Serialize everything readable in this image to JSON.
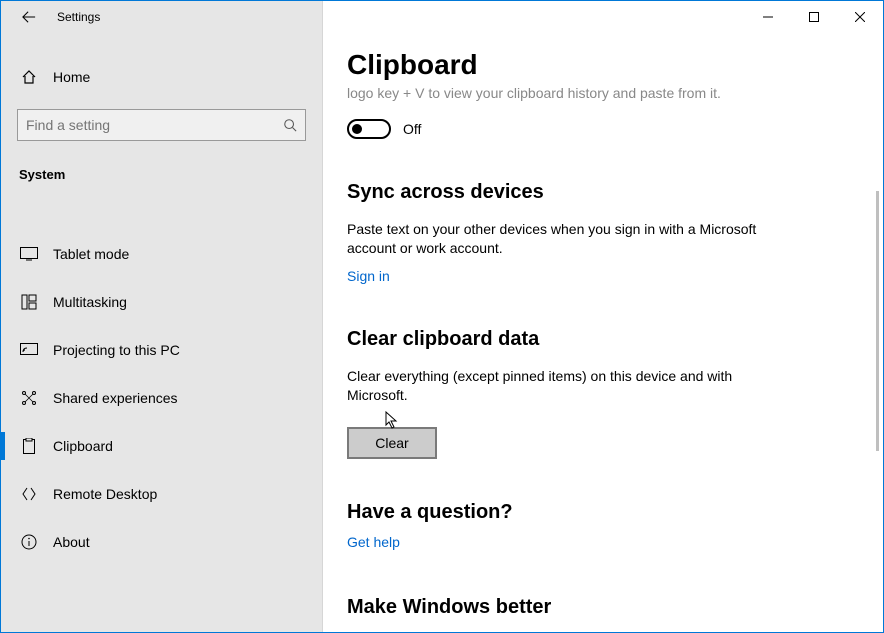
{
  "titlebar": {
    "title": "Settings"
  },
  "home": {
    "label": "Home"
  },
  "search": {
    "placeholder": "Find a setting"
  },
  "category": {
    "label": "System"
  },
  "nav": {
    "items": [
      {
        "label": "Tablet mode"
      },
      {
        "label": "Multitasking"
      },
      {
        "label": "Projecting to this PC"
      },
      {
        "label": "Shared experiences"
      },
      {
        "label": "Clipboard"
      },
      {
        "label": "Remote Desktop"
      },
      {
        "label": "About"
      }
    ]
  },
  "page": {
    "title": "Clipboard",
    "history_cut": "logo key + V to view your clipboard history and paste from it.",
    "toggle_state": "Off",
    "sync": {
      "heading": "Sync across devices",
      "body": "Paste text on your other devices when you sign in with a Microsoft account or work account.",
      "signin": "Sign in"
    },
    "clear": {
      "heading": "Clear clipboard data",
      "body": "Clear everything (except pinned items) on this device and with Microsoft.",
      "button": "Clear"
    },
    "question": {
      "heading": "Have a question?",
      "link": "Get help"
    },
    "feedback": {
      "heading": "Make Windows better"
    }
  }
}
